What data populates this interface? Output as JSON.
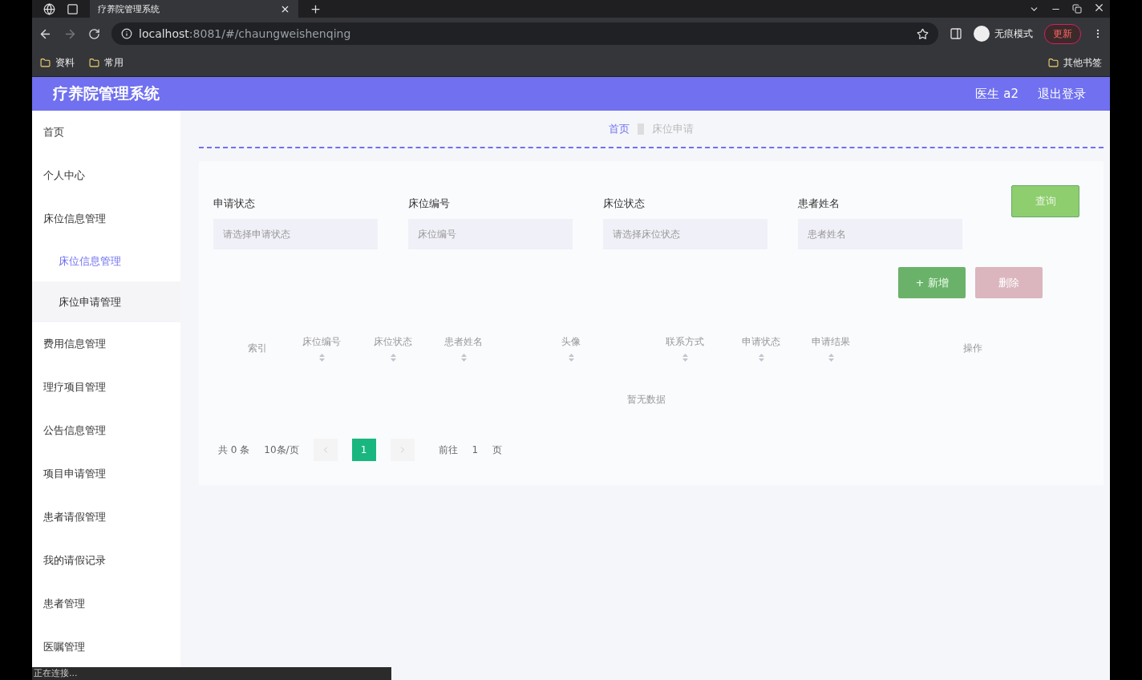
{
  "browser": {
    "tab_title": "疗养院管理系统",
    "url_host": "localhost",
    "url_path": ":8081/#/chaungweishenqing",
    "incognito_label": "无痕模式",
    "update_button": "更新",
    "bookmarks": [
      "资料",
      "常用"
    ],
    "other_bookmarks": "其他书签"
  },
  "header": {
    "title": "疗养院管理系统",
    "user": "医生 a2",
    "logout": "退出登录"
  },
  "sidebar": {
    "items": [
      {
        "label": "首页"
      },
      {
        "label": "个人中心"
      },
      {
        "label": "床位信息管理",
        "children": [
          {
            "label": "床位信息管理",
            "selected": true
          },
          {
            "label": "床位申请管理",
            "selected": false
          }
        ]
      },
      {
        "label": "费用信息管理"
      },
      {
        "label": "理疗项目管理"
      },
      {
        "label": "公告信息管理"
      },
      {
        "label": "项目申请管理"
      },
      {
        "label": "患者请假管理"
      },
      {
        "label": "我的请假记录"
      },
      {
        "label": "患者管理"
      },
      {
        "label": "医嘱管理"
      }
    ]
  },
  "breadcrumb": [
    {
      "label": "首页",
      "selected": true
    },
    {
      "label": "床位申请",
      "selected": false
    }
  ],
  "filters": [
    {
      "label": "申请状态",
      "placeholder": "请选择申请状态"
    },
    {
      "label": "床位编号",
      "placeholder": "床位编号"
    },
    {
      "label": "床位状态",
      "placeholder": "请选择床位状态"
    },
    {
      "label": "患者姓名",
      "placeholder": "患者姓名"
    }
  ],
  "search_button": "查询",
  "actions": [
    {
      "kind": "add",
      "label": "+ 新增"
    },
    {
      "kind": "delete",
      "label": "删除"
    }
  ],
  "table": {
    "columns": [
      {
        "label": "索引",
        "sortable": false
      },
      {
        "label": "床位编号",
        "sortable": true
      },
      {
        "label": "床位状态",
        "sortable": true
      },
      {
        "label": "患者姓名",
        "sortable": true
      },
      {
        "label": "头像",
        "sortable": true
      },
      {
        "label": "联系方式",
        "sortable": true
      },
      {
        "label": "申请状态",
        "sortable": true
      },
      {
        "label": "申请结果",
        "sortable": true
      },
      {
        "label": "操作",
        "sortable": false
      }
    ],
    "empty_text": "暂无数据"
  },
  "pagination": {
    "total": "共 0 条",
    "page_size": "10条/页",
    "pages": [
      {
        "label": "1",
        "selected": true
      }
    ],
    "goto_label": "前往",
    "goto_value": "1",
    "goto_suffix": "页"
  },
  "status_bar": "正在连接..."
}
